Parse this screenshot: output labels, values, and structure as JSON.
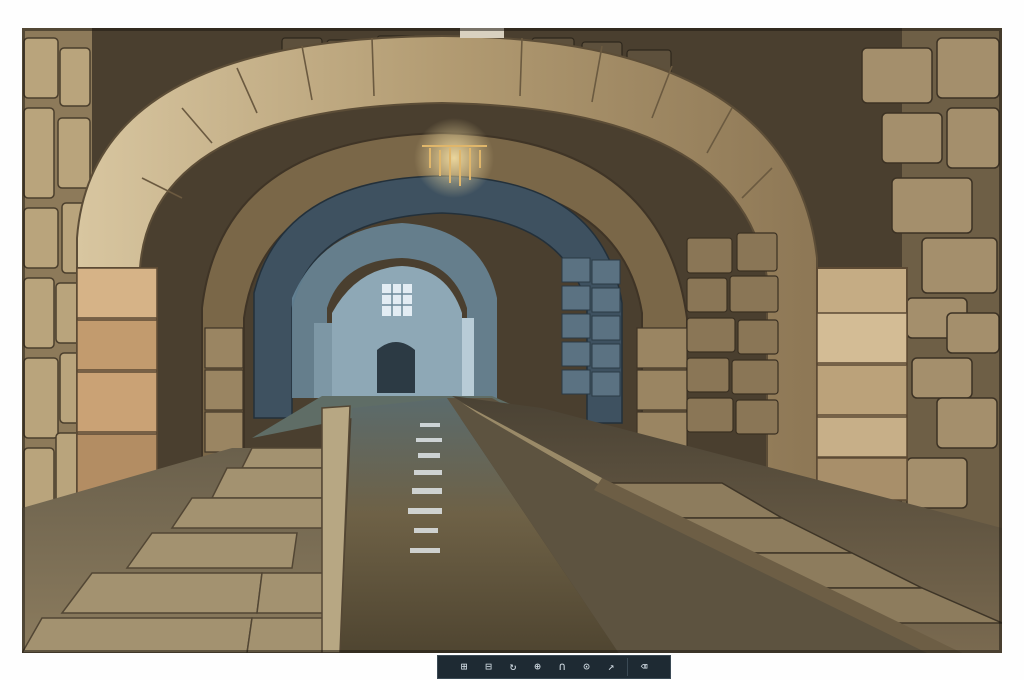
{
  "image": {
    "description_alt": "",
    "palette": {
      "stone_light": "#c9b48a",
      "stone_mid": "#8c7656",
      "stone_dark": "#3e3526",
      "water": "#6e6146",
      "fog_blue": "#7f98a6",
      "window_glow": "#dfe9f2"
    }
  },
  "viewer_toolbar": {
    "buttons": [
      {
        "name": "grid-icon",
        "glyph": "⊞"
      },
      {
        "name": "previous-icon",
        "glyph": "⊟"
      },
      {
        "name": "rotate-icon",
        "glyph": "↻"
      },
      {
        "name": "zoom-icon",
        "glyph": "⊕"
      },
      {
        "name": "fit-icon",
        "glyph": "∩"
      },
      {
        "name": "info-icon",
        "glyph": "⊙"
      },
      {
        "name": "share-icon",
        "glyph": "↗"
      },
      {
        "name": "delete-icon",
        "glyph": "⌫"
      }
    ]
  }
}
